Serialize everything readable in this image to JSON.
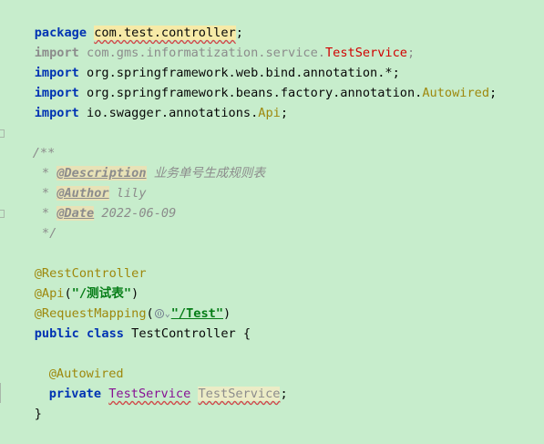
{
  "code": {
    "line1": {
      "kw": "package",
      "pkg": "com.test.controller",
      "semi": ";"
    },
    "line2": {
      "kw": "import",
      "path": "com.gms.informatization.service.",
      "cls": "TestService",
      "semi": ";"
    },
    "line3": {
      "kw": "import",
      "path": "org.springframework.web.bind.annotation.*;"
    },
    "line4": {
      "kw": "import",
      "path": "org.springframework.beans.factory.annotation.",
      "cls": "Autowired",
      "semi": ";"
    },
    "line5": {
      "kw": "import",
      "path": "io.swagger.annotations.",
      "cls": "Api",
      "semi": ";"
    },
    "doc": {
      "open": "/**",
      "star": " * ",
      "tag1": "@Description",
      "val1": "业务单号生成规则表",
      "tag2": "@Author",
      "val2": "lily",
      "tag3": "@Date",
      "val3": "2022-06-09",
      "close": " */"
    },
    "ann1": "@RestController",
    "ann2": {
      "name": "@Api",
      "open": "(",
      "str": "\"/测试表\"",
      "close": ")"
    },
    "ann3": {
      "name": "@RequestMapping",
      "open": "(",
      "chevron": "⌄",
      "str": "\"/Test\"",
      "close": ")"
    },
    "classDecl": {
      "kw1": "public",
      "kw2": "class",
      "name": "TestController",
      "brace": "{"
    },
    "fieldAnn": "@Autowired",
    "field": {
      "kw": "private",
      "type": "TestService",
      "name": "TestService",
      "semi": ";"
    },
    "closeBrace": "}"
  },
  "colors": {
    "background": "#c7edcc",
    "keyword": "#0033b3",
    "annotation": "#9e880d",
    "string": "#067d17",
    "comment": "#8c8c8c",
    "unresolved": "#d10000",
    "field_type": "#871094"
  },
  "icons": {
    "url_icon": "globe-icon",
    "chevron": "chevron-down-icon"
  }
}
